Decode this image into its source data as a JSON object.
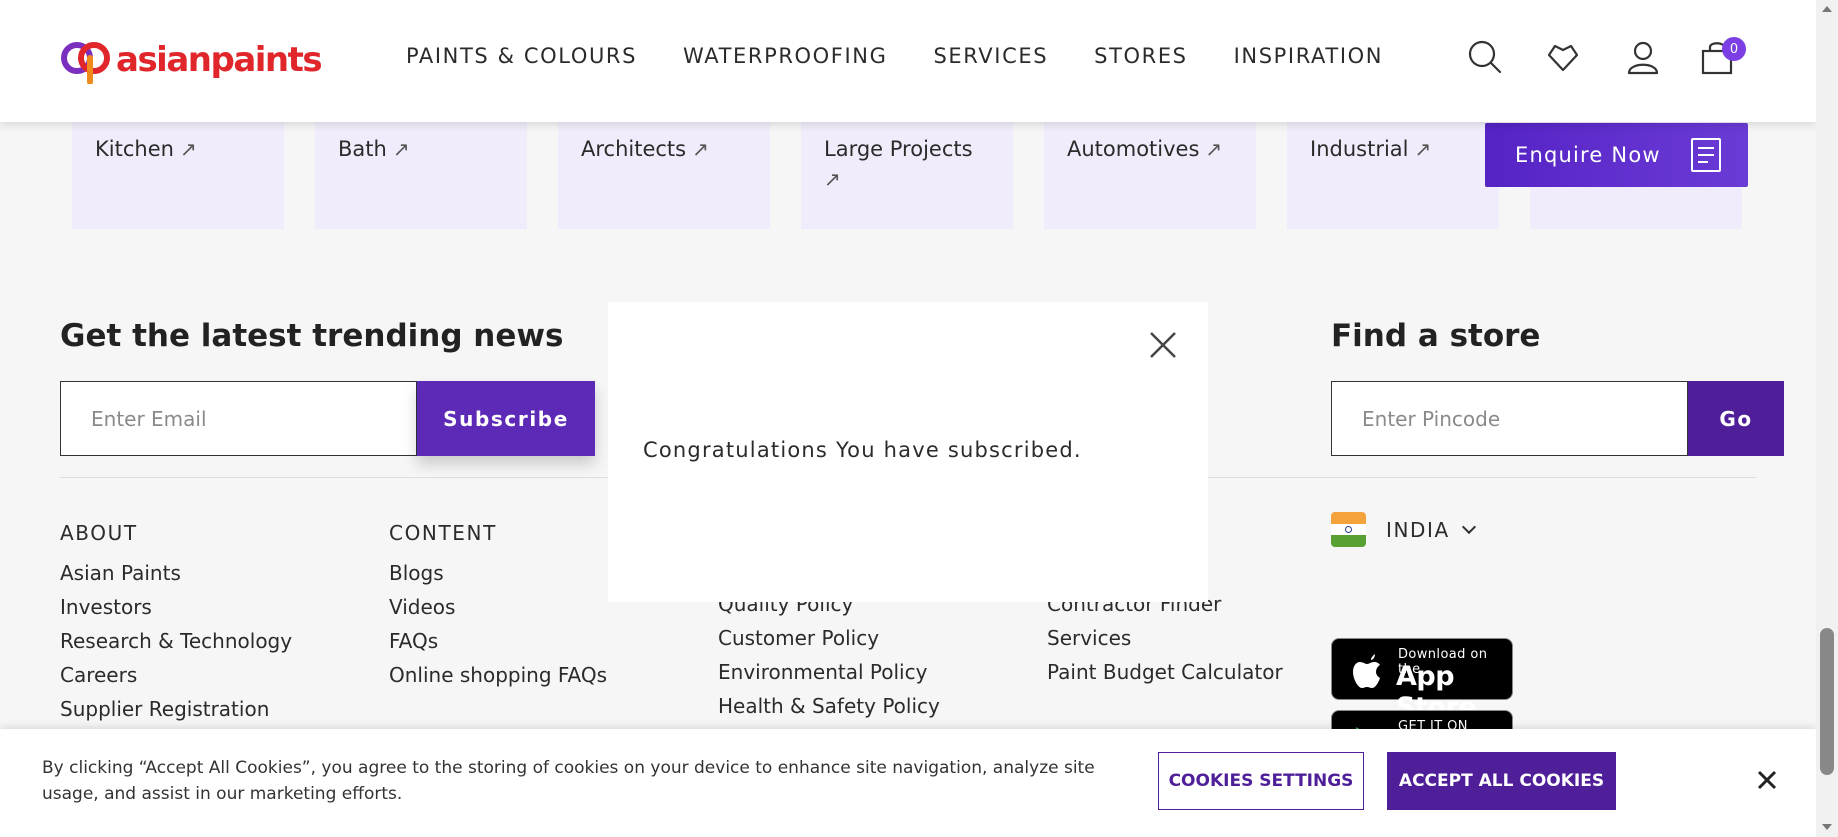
{
  "header": {
    "logo_text": "asianpaints",
    "nav": [
      "PAINTS & COLOURS",
      "WATERPROOFING",
      "SERVICES",
      "STORES",
      "INSPIRATION"
    ],
    "cart_count": "0"
  },
  "tiles": [
    {
      "label": "Kitchen"
    },
    {
      "label": "Bath"
    },
    {
      "label": "Architects"
    },
    {
      "label": "Large Projects"
    },
    {
      "label": "Automotives"
    },
    {
      "label": "Industrial"
    },
    {
      "label": ""
    }
  ],
  "enquire": {
    "label": "Enquire Now"
  },
  "newsletter": {
    "title": "Get the latest trending news",
    "email_placeholder": "Enter Email",
    "subscribe_label": "Subscribe"
  },
  "store": {
    "title": "Find a store",
    "pincode_placeholder": "Enter Pincode",
    "go_label": "Go"
  },
  "footer": {
    "about": {
      "heading": "ABOUT",
      "links": [
        "Asian Paints",
        "Investors",
        "Research & Technology",
        "Careers",
        "Supplier Registration"
      ]
    },
    "content": {
      "heading": "CONTENT",
      "links": [
        "Blogs",
        "Videos",
        "FAQs",
        "Online shopping FAQs"
      ]
    },
    "policies": {
      "links": [
        "Quality Policy",
        "Customer Policy",
        "Environmental Policy",
        "Health & Safety Policy"
      ]
    },
    "tools": {
      "links": [
        "Contractor Finder",
        "Services",
        "Paint Budget Calculator"
      ]
    },
    "country": "INDIA",
    "app_store": {
      "small": "Download on the",
      "big": "App Store"
    },
    "google_play": {
      "small": "GET IT ON"
    }
  },
  "modal": {
    "message": "Congratulations You have subscribed."
  },
  "cookie": {
    "text": "By clicking “Accept All Cookies”, you agree to the storing of cookies on your device to enhance site navigation, analyze site usage, and assist in our marketing efforts.",
    "settings_label": "COOKIES SETTINGS",
    "accept_label": "ACCEPT ALL COOKIES"
  },
  "colors": {
    "brand_red": "#e0262a",
    "brand_purple": "#4e1f98",
    "tile_bg": "#f1ecfb"
  }
}
